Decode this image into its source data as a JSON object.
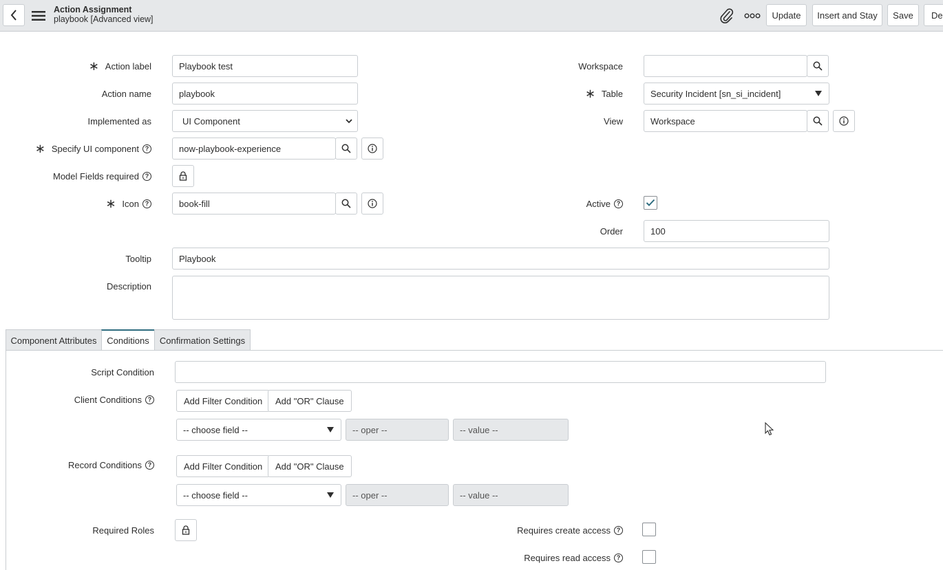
{
  "header": {
    "title": "Action Assignment",
    "subtitle": "playbook [Advanced view]",
    "buttons": {
      "update": "Update",
      "insert_and_stay": "Insert and Stay",
      "save": "Save",
      "delete": "Del"
    }
  },
  "form": {
    "action_label": {
      "label": "Action label",
      "value": "Playbook test"
    },
    "action_name": {
      "label": "Action name",
      "value": "playbook"
    },
    "implemented_as": {
      "label": "Implemented as",
      "value": "UI Component"
    },
    "specify_ui_component": {
      "label": "Specify UI component",
      "value": "now-playbook-experience"
    },
    "model_fields_required": {
      "label": "Model Fields required"
    },
    "icon": {
      "label": "Icon",
      "value": "book-fill"
    },
    "tooltip": {
      "label": "Tooltip",
      "value": "Playbook"
    },
    "description": {
      "label": "Description",
      "value": ""
    },
    "workspace": {
      "label": "Workspace",
      "value": ""
    },
    "table": {
      "label": "Table",
      "value": "Security Incident [sn_si_incident]"
    },
    "view": {
      "label": "View",
      "value": "Workspace"
    },
    "active": {
      "label": "Active",
      "checked": true
    },
    "order": {
      "label": "Order",
      "value": "100"
    }
  },
  "tabs": [
    {
      "label": "Component Attributes",
      "active": false
    },
    {
      "label": "Conditions",
      "active": true
    },
    {
      "label": "Confirmation Settings",
      "active": false
    }
  ],
  "conditions": {
    "script_condition": {
      "label": "Script Condition",
      "value": ""
    },
    "client_conditions": {
      "label": "Client Conditions",
      "add_filter": "Add Filter Condition",
      "add_or": "Add \"OR\" Clause",
      "field": "-- choose field --",
      "oper": "-- oper --",
      "value": "-- value --"
    },
    "record_conditions": {
      "label": "Record Conditions",
      "add_filter": "Add Filter Condition",
      "add_or": "Add \"OR\" Clause",
      "field": "-- choose field --",
      "oper": "-- oper --",
      "value": "-- value --"
    },
    "required_roles": {
      "label": "Required Roles"
    },
    "requires_create_access": {
      "label": "Requires create access",
      "checked": false
    },
    "requires_read_access": {
      "label": "Requires read access",
      "checked": false
    }
  }
}
